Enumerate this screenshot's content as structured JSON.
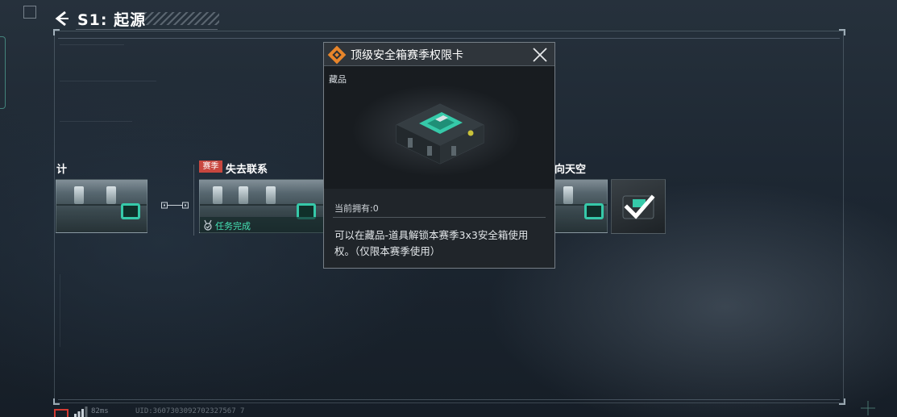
{
  "header": {
    "season_title": "S1:  起源"
  },
  "quests": {
    "left_partial_title": "计",
    "season_badge": "赛季",
    "lost_contact_title": "失去联系",
    "complete_label": "任务完成",
    "right_partial_title": "向天空"
  },
  "modal": {
    "title": "顶级安全箱赛季权限卡",
    "category": "藏品",
    "owned": "当前拥有:0",
    "description": "可以在藏品-道具解锁本赛季3x3安全箱使用权。（仅限本赛季使用）"
  },
  "footer": {
    "ping": "82ms",
    "uid": "UID:3607303092702327567 7"
  },
  "colors": {
    "accent_teal": "#45e2b5",
    "season_red": "#c8473f",
    "modal_icon_orange": "#e8852a"
  },
  "icons": {
    "back": "chevron-left-icon",
    "close": "close-icon",
    "item": "diamond-item-icon",
    "check": "checkmark-icon",
    "medal": "medal-icon",
    "signal": "signal-bars-icon"
  }
}
